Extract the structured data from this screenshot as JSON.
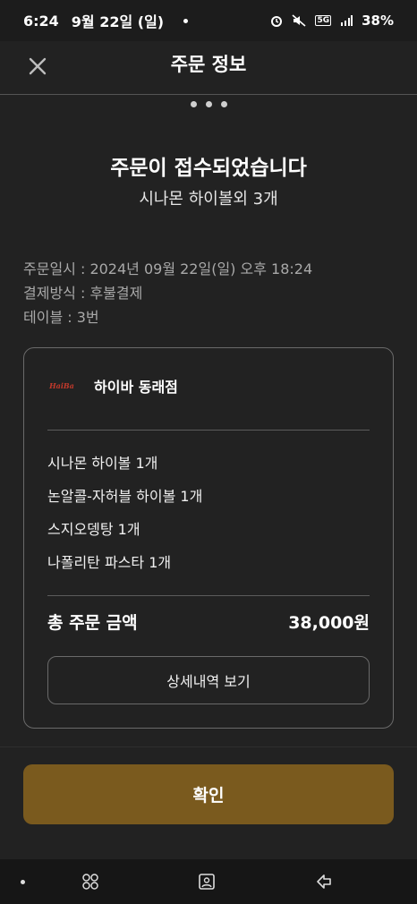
{
  "status_bar": {
    "time": "6:24",
    "date": "9월 22일 (일)",
    "battery": "38%",
    "network_badge": "5G"
  },
  "header": {
    "title": "주문 정보",
    "close_icon": "close-icon"
  },
  "order": {
    "headline": "주문이 접수되었습니다",
    "summary": "시나몬 하이볼외 3개",
    "datetime_line": "주문일시 : 2024년 09월 22일(일) 오후 18:24",
    "payment_line": "결제방식 : 후불결제",
    "table_line": "테이블 : 3번"
  },
  "store": {
    "logo_text": "HaiBa",
    "name": "하이바 동래점"
  },
  "items": [
    "시나몬 하이볼 1개",
    "논알콜-자허블 하이볼 1개",
    "스지오뎅탕 1개",
    "나폴리탄 파스타 1개"
  ],
  "total": {
    "label": "총 주문 금액",
    "amount": "38,000원"
  },
  "buttons": {
    "detail": "상세내역 보기",
    "confirm": "확인"
  },
  "colors": {
    "background": "#222222",
    "confirm_button": "#7a5a1e",
    "info_text": "#a9a9a9"
  }
}
